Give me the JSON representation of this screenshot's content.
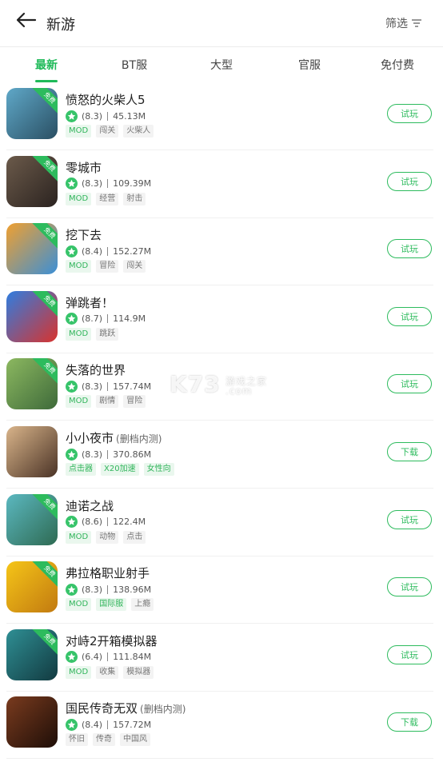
{
  "header": {
    "title": "新游",
    "filter_label": "筛选"
  },
  "tabs": [
    {
      "label": "最新"
    },
    {
      "label": "BT服"
    },
    {
      "label": "大型"
    },
    {
      "label": "官服"
    },
    {
      "label": "免付费"
    }
  ],
  "watermark": {
    "logo": "K73",
    "line1": "游戏之家",
    "line2": ".com"
  },
  "games": [
    {
      "name": "愤怒的火柴人5",
      "note": "",
      "rating": "(8.3)",
      "size": "45.13M",
      "tags": [
        {
          "t": "MOD",
          "g": true
        },
        {
          "t": "闯关",
          "g": false
        },
        {
          "t": "火柴人",
          "g": false
        }
      ],
      "btn": "试玩",
      "ribbon": "免费",
      "color": "#5fa8c8",
      "color2": "#2a4f63"
    },
    {
      "name": "零城市",
      "note": "",
      "rating": "(8.3)",
      "size": "109.39M",
      "tags": [
        {
          "t": "MOD",
          "g": true
        },
        {
          "t": "经营",
          "g": false
        },
        {
          "t": "射击",
          "g": false
        }
      ],
      "btn": "试玩",
      "ribbon": "免费",
      "color": "#6b5a4a",
      "color2": "#2b2320"
    },
    {
      "name": "挖下去",
      "note": "",
      "rating": "(8.4)",
      "size": "152.27M",
      "tags": [
        {
          "t": "MOD",
          "g": true
        },
        {
          "t": "冒险",
          "g": false
        },
        {
          "t": "闯关",
          "g": false
        }
      ],
      "btn": "试玩",
      "ribbon": "免费",
      "color": "#f0a030",
      "color2": "#3b8fd6"
    },
    {
      "name": "弹跳者！",
      "note": "",
      "rating": "(8.7)",
      "size": "114.9M",
      "tags": [
        {
          "t": "MOD",
          "g": true
        },
        {
          "t": "跳跃",
          "g": false
        }
      ],
      "btn": "试玩",
      "ribbon": "免费",
      "color": "#2f7de0",
      "color2": "#d8332e"
    },
    {
      "name": "失落的世界",
      "note": "",
      "rating": "(8.3)",
      "size": "157.74M",
      "tags": [
        {
          "t": "MOD",
          "g": true
        },
        {
          "t": "剧情",
          "g": false
        },
        {
          "t": "冒险",
          "g": false
        }
      ],
      "btn": "试玩",
      "ribbon": "免费",
      "color": "#8cb860",
      "color2": "#3e6a3a"
    },
    {
      "name": "小小夜市",
      "note": "(删档内测)",
      "rating": "(8.3)",
      "size": "370.86M",
      "tags": [
        {
          "t": "点击器",
          "g": true
        },
        {
          "t": "X20加速",
          "g": true
        },
        {
          "t": "女性向",
          "g": true
        }
      ],
      "btn": "下载",
      "ribbon": "",
      "color": "#d9b48a",
      "color2": "#4a3326"
    },
    {
      "name": "迪诺之战",
      "note": "",
      "rating": "(8.6)",
      "size": "122.4M",
      "tags": [
        {
          "t": "MOD",
          "g": true
        },
        {
          "t": "动物",
          "g": false
        },
        {
          "t": "点击",
          "g": false
        }
      ],
      "btn": "试玩",
      "ribbon": "免费",
      "color": "#5bb8c0",
      "color2": "#2e6a52"
    },
    {
      "name": "弗拉格职业射手",
      "note": "",
      "rating": "(8.3)",
      "size": "138.96M",
      "tags": [
        {
          "t": "MOD",
          "g": true
        },
        {
          "t": "国际服",
          "g": true
        },
        {
          "t": "上瘾",
          "g": false
        }
      ],
      "btn": "试玩",
      "ribbon": "免费",
      "color": "#f5c518",
      "color2": "#c27a10"
    },
    {
      "name": "对峙2开箱模拟器",
      "note": "",
      "rating": "(6.4)",
      "size": "111.84M",
      "tags": [
        {
          "t": "MOD",
          "g": true
        },
        {
          "t": "收集",
          "g": false
        },
        {
          "t": "模拟器",
          "g": false
        }
      ],
      "btn": "试玩",
      "ribbon": "免费",
      "color": "#2f8f94",
      "color2": "#123a40"
    },
    {
      "name": "国民传奇无双",
      "note": "(删档内测)",
      "rating": "(8.4)",
      "size": "157.72M",
      "tags": [
        {
          "t": "怀旧",
          "g": false
        },
        {
          "t": "传奇",
          "g": false
        },
        {
          "t": "中国风",
          "g": false
        }
      ],
      "btn": "下载",
      "ribbon": "",
      "color": "#7a3b1e",
      "color2": "#1e0e08"
    }
  ]
}
